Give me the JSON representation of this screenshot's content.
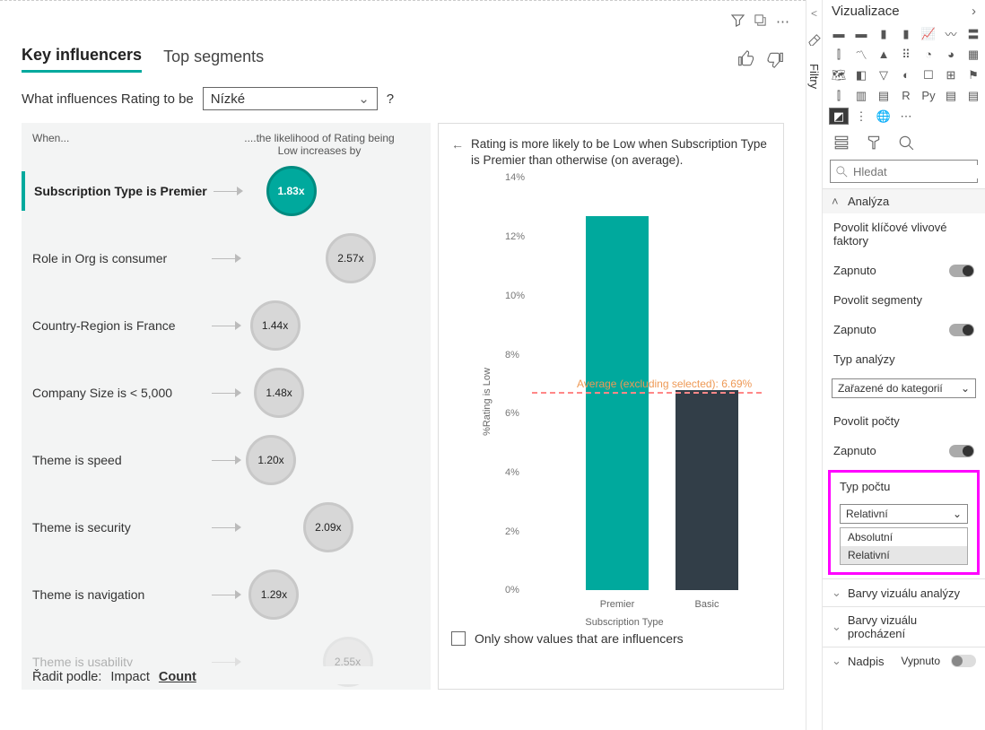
{
  "canvas": {
    "header_icons": {
      "filter": "filter-icon",
      "focus": "focus-icon",
      "more": "ellipsis-icon"
    }
  },
  "ki": {
    "tabs": {
      "key_influencers": "Key influencers",
      "top_segments": "Top segments"
    },
    "question_prefix": "What influences Rating to be",
    "question_dropdown_value": "Nízké",
    "question_help": "?",
    "left_header_when": "When...",
    "left_header_likely": "....the likelihood of Rating being Low increases by",
    "left_footer": {
      "label": "Řadit podle:",
      "impact": "Impact",
      "count": "Count"
    },
    "influencers": [
      {
        "label": "Subscription Type is Premier",
        "value": "1.83x",
        "selected": true,
        "pos_pct": 18
      },
      {
        "label": "Role in Org is consumer",
        "value": "2.57x",
        "selected": false,
        "pos_pct": 78
      },
      {
        "label": "Country-Region is France",
        "value": "1.44x",
        "selected": false,
        "pos_pct": 4
      },
      {
        "label": "Company Size is < 5,000",
        "value": "1.48x",
        "selected": false,
        "pos_pct": 8
      },
      {
        "label": "Theme is speed",
        "value": "1.20x",
        "selected": false,
        "pos_pct": 0
      },
      {
        "label": "Theme is security",
        "value": "2.09x",
        "selected": false,
        "pos_pct": 56
      },
      {
        "label": "Theme is navigation",
        "value": "1.29x",
        "selected": false,
        "pos_pct": 3
      },
      {
        "label": "Theme is usability",
        "value": "2.55x",
        "selected": false,
        "pos_pct": 75
      }
    ],
    "rp_text": "Rating is more likely to be Low when Subscription Type is Premier than otherwise (on average).",
    "avg_label": "Average (excluding selected): 6.69%",
    "only_influencers": "Only show values that are influencers"
  },
  "chart_data": {
    "type": "bar",
    "title": "",
    "xlabel": "Subscription Type",
    "ylabel": "%Rating is Low",
    "ylim": [
      0,
      14
    ],
    "yticks": [
      "0%",
      "2%",
      "4%",
      "6%",
      "8%",
      "10%",
      "12%",
      "14%"
    ],
    "categories": [
      "Premier",
      "Basic"
    ],
    "values": [
      12.7,
      6.8
    ],
    "reference_value": 6.69
  },
  "filtry_rail": {
    "expand": "<",
    "label": "Filtry"
  },
  "viz": {
    "title": "Vizualizace",
    "search_placeholder": "Hledat",
    "sections": {
      "analysis": {
        "title": "Analýza",
        "enable_ki": {
          "label": "Povolit klíčové vlivové faktory",
          "toggle": "Zapnuto"
        },
        "enable_segments": {
          "label": "Povolit segmenty",
          "toggle": "Zapnuto"
        },
        "analysis_type": {
          "label": "Typ analýzy",
          "value": "Zařazené do kategorií"
        },
        "enable_counts": {
          "label": "Povolit počty",
          "toggle": "Zapnuto"
        },
        "count_type": {
          "label": "Typ počtu",
          "value": "Relativní",
          "options": [
            "Absolutní",
            "Relativní"
          ]
        }
      },
      "collapsed_1": {
        "label": "Barvy vizuálu analýzy"
      },
      "collapsed_2": {
        "label": "Barvy vizuálu procházení"
      },
      "collapsed_3": {
        "label": "Nadpis",
        "state": "Vypnuto"
      }
    },
    "gallery_icons": [
      "stacked-bar",
      "clustered-bar",
      "stacked-column",
      "clustered-column",
      "line",
      "area",
      "stacked-area",
      "line-column",
      "ribbon",
      "waterfall",
      "scatter",
      "pie",
      "donut",
      "treemap",
      "map",
      "filled-map",
      "funnel",
      "gauge",
      "card",
      "multi-card",
      "kpi",
      "slicer",
      "table",
      "matrix",
      "r",
      "python",
      "py",
      "table2",
      "key-influencer",
      "decomposition",
      "paginated",
      "more"
    ]
  }
}
